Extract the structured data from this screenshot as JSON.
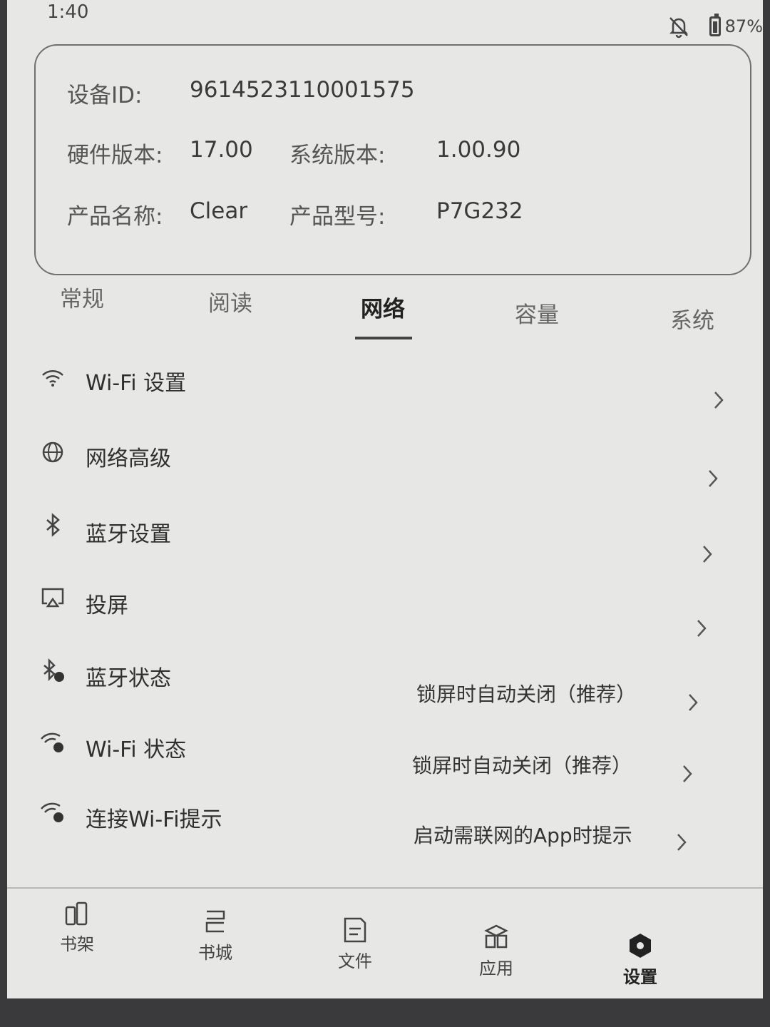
{
  "status_bar": {
    "time": "1:40",
    "battery": "87%",
    "icons": [
      "notifications-off-icon",
      "battery-icon"
    ]
  },
  "device_info": {
    "device_id_label": "设备ID:",
    "device_id": "9614523110001575",
    "hardware_version_label": "硬件版本:",
    "hardware_version": "17.00",
    "system_version_label": "系统版本:",
    "system_version": "1.00.90",
    "product_name_label": "产品名称:",
    "product_name": "Clear",
    "product_model_label": "产品型号:",
    "product_model": "P7G232"
  },
  "tabs": [
    {
      "label": "常规",
      "active": false
    },
    {
      "label": "阅读",
      "active": false
    },
    {
      "label": "网络",
      "active": true
    },
    {
      "label": "容量",
      "active": false
    },
    {
      "label": "系统",
      "active": false
    }
  ],
  "menu": [
    {
      "icon": "wifi-icon",
      "label": "Wi-Fi 设置",
      "value": ""
    },
    {
      "icon": "globe-icon",
      "label": "网络高级",
      "value": ""
    },
    {
      "icon": "bluetooth-icon",
      "label": "蓝牙设置",
      "value": ""
    },
    {
      "icon": "cast-icon",
      "label": "投屏",
      "value": ""
    },
    {
      "icon": "bluetooth-status-icon",
      "label": "蓝牙状态",
      "value": "锁屏时自动关闭（推荐）"
    },
    {
      "icon": "wifi-status-icon",
      "label": "Wi-Fi 状态",
      "value": "锁屏时自动关闭（推荐）"
    },
    {
      "icon": "wifi-prompt-icon",
      "label": "连接Wi-Fi提示",
      "value": "启动需联网的App时提示"
    }
  ],
  "bottom_nav": [
    {
      "icon": "bookshelf-icon",
      "label": "书架",
      "active": false
    },
    {
      "icon": "bookstore-icon",
      "label": "书城",
      "active": false
    },
    {
      "icon": "file-icon",
      "label": "文件",
      "active": false
    },
    {
      "icon": "apps-icon",
      "label": "应用",
      "active": false
    },
    {
      "icon": "settings-icon",
      "label": "设置",
      "active": true
    }
  ]
}
